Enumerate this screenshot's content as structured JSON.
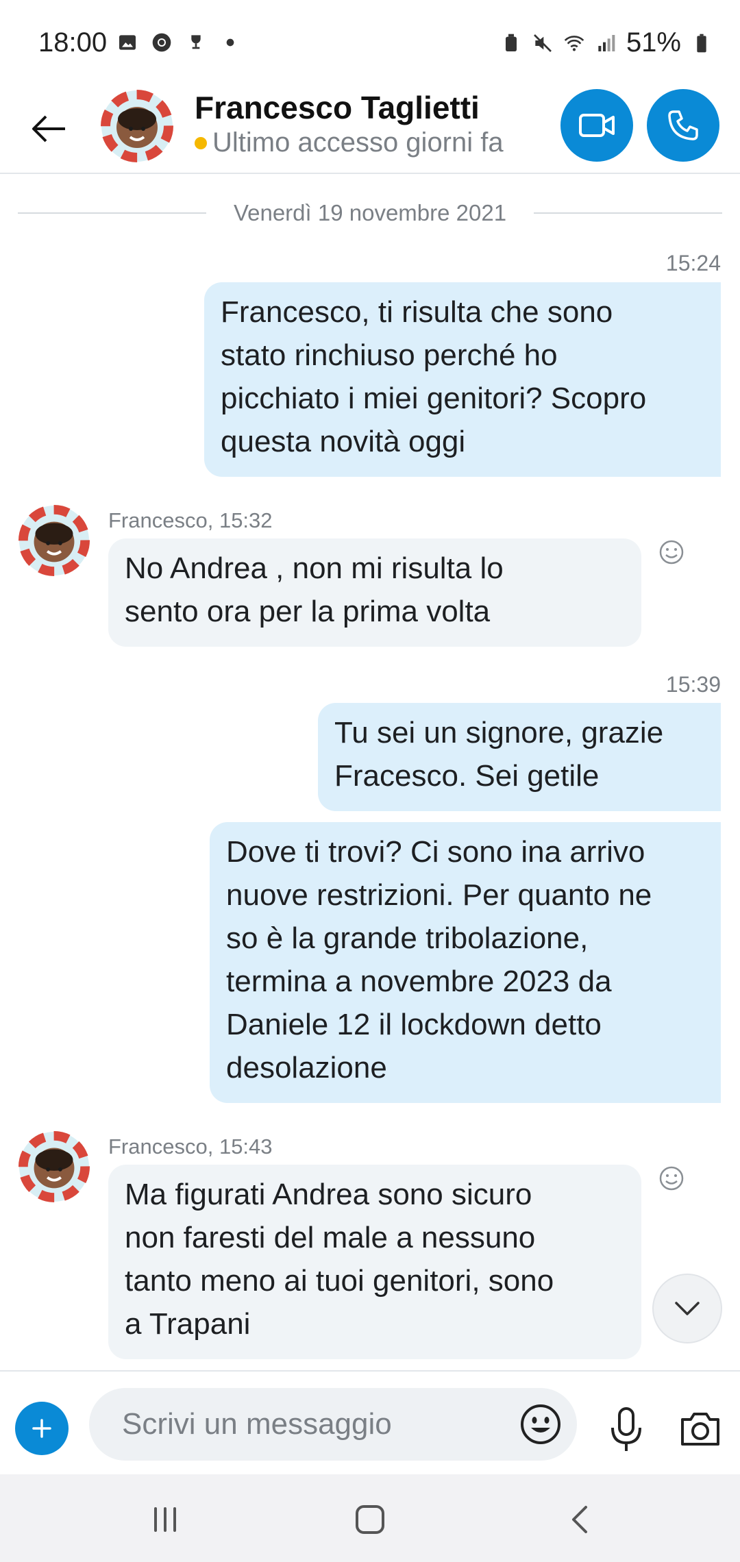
{
  "status_bar": {
    "time": "18:00",
    "battery": "51%",
    "left_icons": [
      "gallery-icon",
      "chrome-icon",
      "trophy-icon",
      "dot-icon"
    ],
    "right_icons": [
      "alarm-icon",
      "mute-icon",
      "wifi-icon",
      "signal-icon",
      "battery-icon"
    ]
  },
  "header": {
    "contact_name": "Francesco Taglietti",
    "contact_status": "Ultimo accesso giorni fa",
    "status_color": "#f5b800",
    "accent": "#0a8ad6"
  },
  "chat": {
    "date_separator": "Venerdì 19 novembre 2021",
    "messages": [
      {
        "direction": "out",
        "time": "15:24",
        "lines": [
          "Francesco, ti risulta che sono",
          "stato rinchiuso perché ho",
          "picchiato i miei genitori? Scopro",
          "questa novità oggi"
        ]
      },
      {
        "direction": "in",
        "meta": "Francesco, 15:32",
        "lines": [
          "No Andrea , non mi risulta lo",
          "sento ora per la prima volta"
        ]
      },
      {
        "direction": "out",
        "time": "15:39",
        "lines": [
          "Tu sei un signore, grazie",
          "Fracesco. Sei getile"
        ]
      },
      {
        "direction": "out",
        "lines": [
          "Dove ti trovi? Ci sono ina arrivo",
          "nuove restrizioni. Per quanto ne",
          "so è la grande tribolazione,",
          "termina a novembre 2023 da",
          "Daniele 12 il lockdown detto",
          "desolazione"
        ]
      },
      {
        "direction": "in",
        "meta": "Francesco, 15:43",
        "lines": [
          "Ma figurati Andrea sono sicuro",
          "non faresti del male a nessuno",
          "tanto meno ai tuoi genitori, sono",
          "a Trapani"
        ]
      }
    ]
  },
  "composer": {
    "placeholder": "Scrivi un messaggio"
  },
  "navbar": {
    "items": [
      "recents-icon",
      "home-icon",
      "back-icon"
    ]
  }
}
